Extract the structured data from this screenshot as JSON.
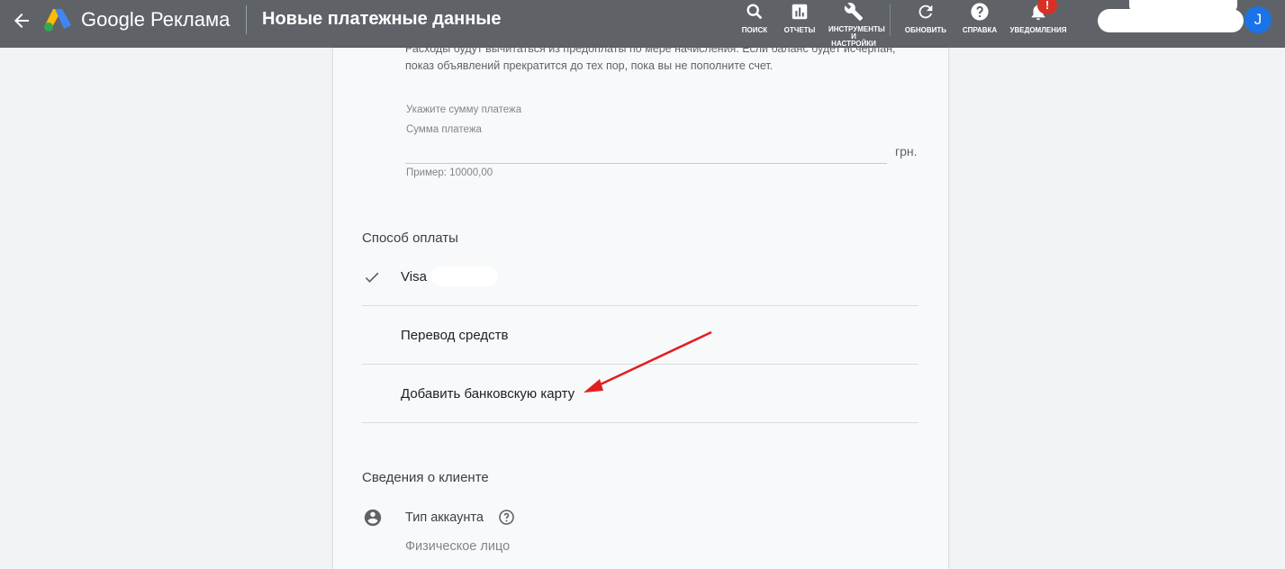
{
  "header": {
    "brand": "Google Реклама",
    "page_title": "Новые платежные данные",
    "tools": [
      {
        "icon": "search-icon",
        "label": "ПОИСК"
      },
      {
        "icon": "reports-icon",
        "label": "ОТЧЕТЫ"
      },
      {
        "icon": "wrench-icon",
        "label": "ИНСТРУМЕНТЫ И НАСТРОЙКИ"
      },
      {
        "icon": "refresh-icon",
        "label": "ОБНОВИТЬ"
      },
      {
        "icon": "help-icon",
        "label": "СПРАВКА"
      },
      {
        "icon": "bell-icon",
        "label": "УВЕДОМЛЕНИЯ"
      }
    ],
    "notification_badge": "!",
    "avatar_letter": "J",
    "accent": "#1a73e8",
    "badge_color": "#d93025"
  },
  "prepay": {
    "info_line1": "Расходы будут вычитаться из предоплаты по мере начисления. Если баланс будет исчерпан,",
    "info_line2": "показ объявлений прекратится до тех пор, пока вы не пополните счет.",
    "prompt": "Укажите сумму платежа",
    "field_label": "Сумма платежа",
    "amount_value": "",
    "currency": "грн.",
    "hint": "Пример: 10000,00"
  },
  "payment_method": {
    "title": "Способ оплаты",
    "options": [
      {
        "label": "Visa",
        "selected": true
      },
      {
        "label": "Перевод средств",
        "selected": false
      },
      {
        "label": "Добавить банковскую карту",
        "selected": false
      }
    ]
  },
  "client_info": {
    "title": "Сведения о клиенте",
    "account_type_label": "Тип аккаунта",
    "account_type_value": "Физическое лицо"
  }
}
